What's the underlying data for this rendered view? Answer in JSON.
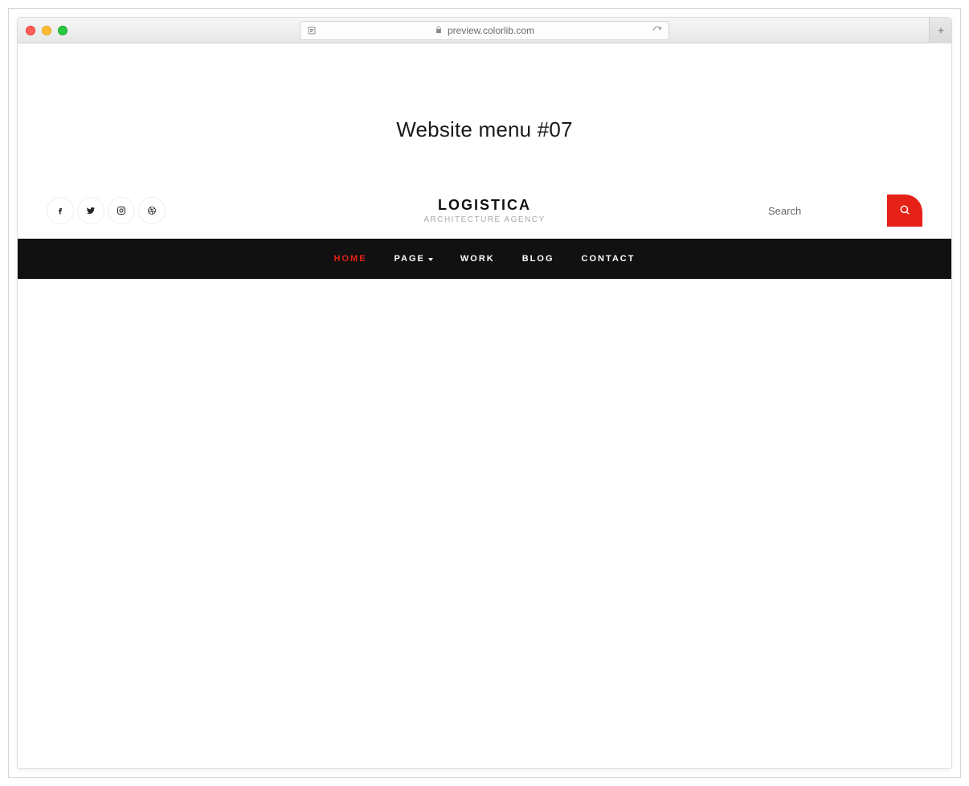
{
  "browser": {
    "url": "preview.colorlib.com"
  },
  "page_heading": "Website menu #07",
  "logo": {
    "name": "LOGISTICA",
    "tagline": "ARCHITECTURE AGENCY"
  },
  "social_icons": [
    {
      "name": "facebook-icon"
    },
    {
      "name": "twitter-icon"
    },
    {
      "name": "instagram-icon"
    },
    {
      "name": "dribbble-icon"
    }
  ],
  "search": {
    "placeholder": "Search"
  },
  "nav": {
    "items": [
      {
        "label": "HOME",
        "active": true,
        "has_caret": false
      },
      {
        "label": "PAGE",
        "active": false,
        "has_caret": true
      },
      {
        "label": "WORK",
        "active": false,
        "has_caret": false
      },
      {
        "label": "BLOG",
        "active": false,
        "has_caret": false
      },
      {
        "label": "CONTACT",
        "active": false,
        "has_caret": false
      }
    ]
  }
}
